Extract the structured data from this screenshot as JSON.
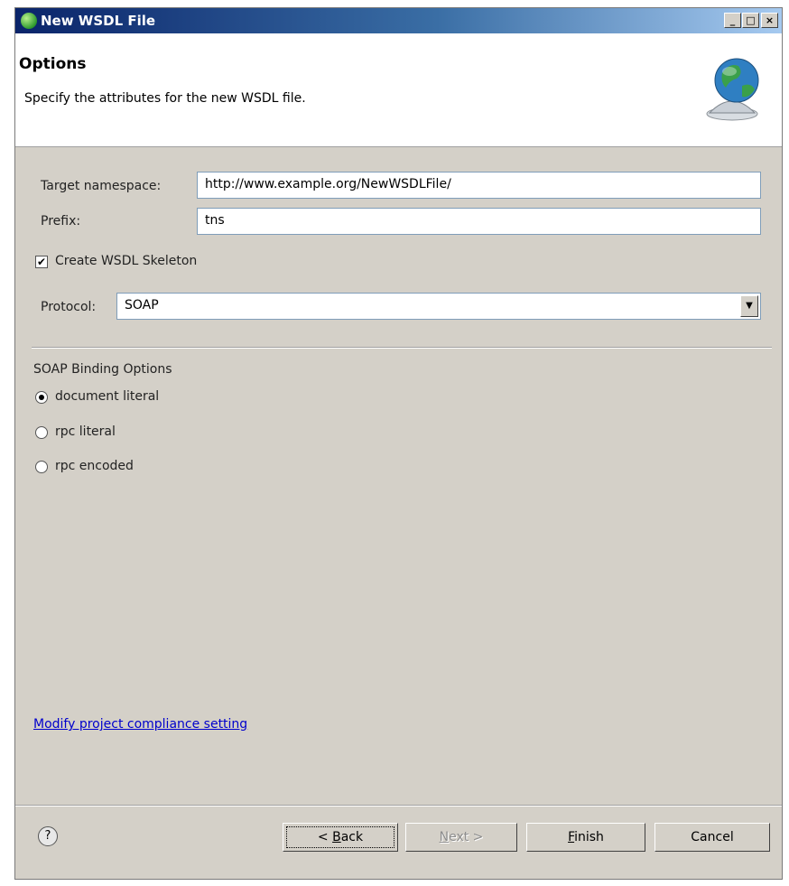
{
  "window": {
    "title": "New WSDL File"
  },
  "banner": {
    "title": "Options",
    "description": "Specify the attributes for the new WSDL file."
  },
  "form": {
    "target_namespace_label": "Target namespace:",
    "target_namespace_value": "http://www.example.org/NewWSDLFile/",
    "prefix_label": "Prefix:",
    "prefix_value": "tns",
    "create_skeleton_label": "Create WSDL Skeleton",
    "create_skeleton_checked": true,
    "protocol_label": "Protocol:",
    "protocol_value": "SOAP"
  },
  "binding": {
    "heading": "SOAP Binding Options",
    "options": [
      {
        "label": "document literal",
        "selected": true
      },
      {
        "label": "rpc literal",
        "selected": false
      },
      {
        "label": "rpc encoded",
        "selected": false
      }
    ]
  },
  "compliance_link": "Modify project compliance setting",
  "buttons": {
    "help": "?",
    "back_prefix": "< ",
    "back_mnemonic": "B",
    "back_rest": "ack",
    "next_mnemonic": "N",
    "next_rest": "ext >",
    "finish_mnemonic": "F",
    "finish_rest": "inish",
    "cancel": "Cancel"
  },
  "icons": {
    "app": "wsdl-wizard-icon",
    "banner": "globe-service-bell-icon"
  }
}
